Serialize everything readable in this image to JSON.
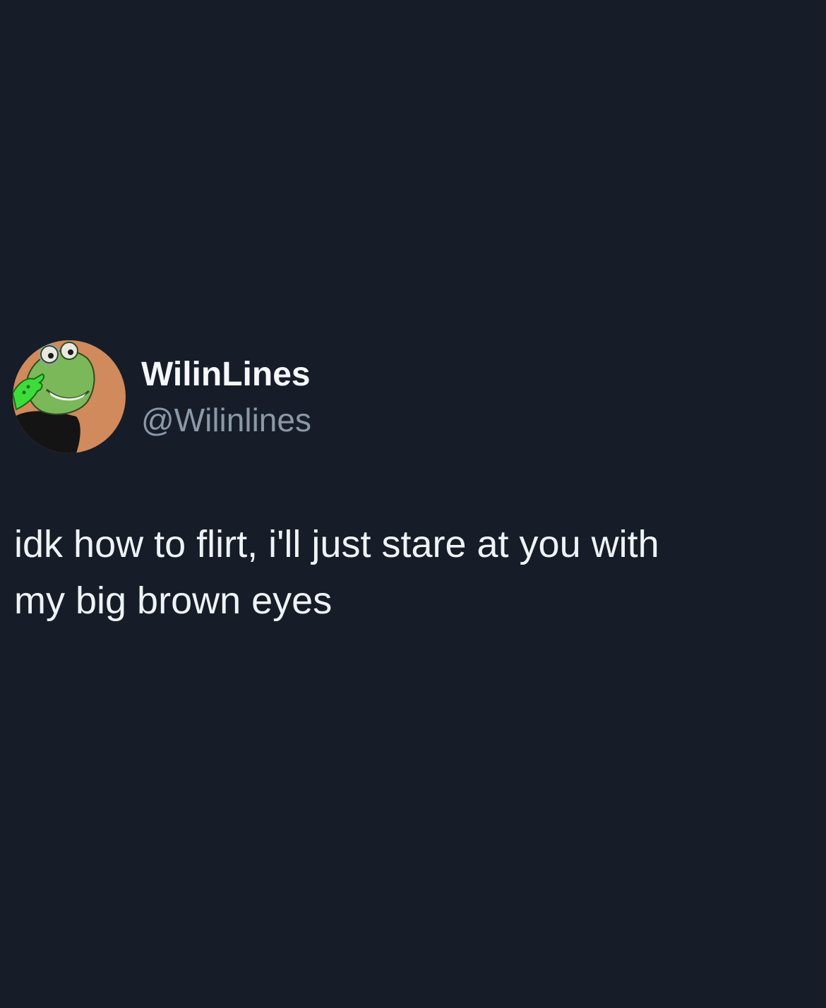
{
  "tweet": {
    "author": {
      "display_name": "WilinLines",
      "handle": "@Wilinlines",
      "avatar_icon": "frog-avatar-icon"
    },
    "text": "idk how to flirt, i'll just stare at you with\nmy big brown eyes"
  },
  "colors": {
    "background": "#161d28",
    "primary_text": "#f0f3f5",
    "secondary_text": "#8b98a5",
    "avatar_bg": "#d08a5c",
    "frog_green": "#7bb85a",
    "hand_green": "#3ddc3a"
  }
}
